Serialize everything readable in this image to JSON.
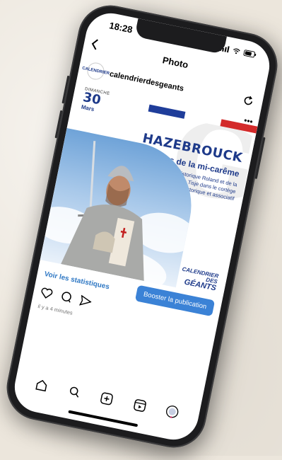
{
  "status_bar": {
    "time": "18:28"
  },
  "header": {
    "title": "Photo"
  },
  "account": {
    "name": "calendrierdesgeants",
    "avatar_text": "CALENDRIER"
  },
  "post": {
    "day_name": "DIMANCHE",
    "day_number": "30",
    "month": "Mars",
    "city": "HAZEBROUCK",
    "event_title": "Fêtes de la mi-carême",
    "description": "Sortie du géant historique Roland et de la famille Tisje Tisje dans le cortège historique et associatif",
    "brand_line1": "CALENDRIER",
    "brand_line2": "DES",
    "brand_line3": "GÉANTS",
    "flag_colors": [
      "#1f3d9a",
      "#ffffff",
      "#d32a2a"
    ]
  },
  "stats": {
    "link": "Voir les statistiques",
    "boost": "Booster la publication"
  },
  "meta": {
    "time_ago": "il y a 4 minutes"
  },
  "tabs": [
    "home",
    "search",
    "create",
    "reels",
    "profile"
  ],
  "colors": {
    "brand_blue": "#1e3a8a",
    "link_blue": "#2f78c4",
    "button_blue": "#3b82d6"
  }
}
